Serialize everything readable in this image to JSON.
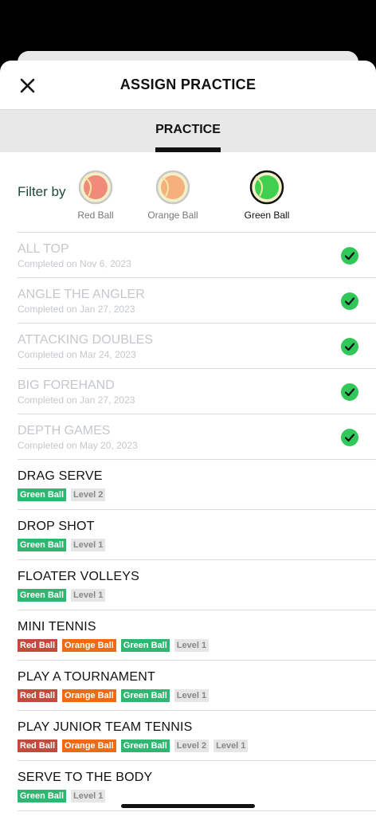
{
  "header": {
    "title": "ASSIGN PRACTICE"
  },
  "tabs": [
    {
      "label": "PRACTICE"
    }
  ],
  "filter": {
    "label": "Filter by",
    "balls": [
      {
        "label": "Red Ball",
        "color": "#f08a7a",
        "active": false
      },
      {
        "label": "Orange Ball",
        "color": "#f5b07e",
        "active": false
      },
      {
        "label": "Green Ball",
        "color": "#3fd04f",
        "active": true
      }
    ]
  },
  "completed": [
    {
      "name": "ALL TOP",
      "date": "Completed on Nov 6, 2023"
    },
    {
      "name": "ANGLE THE ANGLER",
      "date": "Completed on Jan 27, 2023"
    },
    {
      "name": "ATTACKING DOUBLES",
      "date": "Completed on Mar 24, 2023"
    },
    {
      "name": "BIG FOREHAND",
      "date": "Completed on Jan 27, 2023"
    },
    {
      "name": "DEPTH GAMES",
      "date": "Completed on May 20, 2023"
    }
  ],
  "practices": [
    {
      "name": "DRAG SERVE",
      "tags": [
        {
          "label": "Green Ball",
          "type": "green"
        },
        {
          "label": "Level 2",
          "type": "level"
        }
      ]
    },
    {
      "name": "DROP SHOT",
      "tags": [
        {
          "label": "Green Ball",
          "type": "green"
        },
        {
          "label": "Level 1",
          "type": "level"
        }
      ]
    },
    {
      "name": "FLOATER VOLLEYS",
      "tags": [
        {
          "label": "Green Ball",
          "type": "green"
        },
        {
          "label": "Level 1",
          "type": "level"
        }
      ]
    },
    {
      "name": "MINI TENNIS",
      "tags": [
        {
          "label": "Red Ball",
          "type": "red"
        },
        {
          "label": "Orange Ball",
          "type": "orange"
        },
        {
          "label": "Green Ball",
          "type": "green"
        },
        {
          "label": "Level 1",
          "type": "level"
        }
      ]
    },
    {
      "name": "PLAY A TOURNAMENT",
      "tags": [
        {
          "label": "Red Ball",
          "type": "red"
        },
        {
          "label": "Orange Ball",
          "type": "orange"
        },
        {
          "label": "Green Ball",
          "type": "green"
        },
        {
          "label": "Level 1",
          "type": "level"
        }
      ]
    },
    {
      "name": "PLAY JUNIOR TEAM TENNIS",
      "tags": [
        {
          "label": "Red Ball",
          "type": "red"
        },
        {
          "label": "Orange Ball",
          "type": "orange"
        },
        {
          "label": "Green Ball",
          "type": "green"
        },
        {
          "label": "Level 2",
          "type": "level"
        },
        {
          "label": "Level 1",
          "type": "level"
        }
      ]
    },
    {
      "name": "SERVE TO THE BODY",
      "tags": [
        {
          "label": "Green Ball",
          "type": "green"
        },
        {
          "label": "Level 1",
          "type": "level"
        }
      ]
    }
  ],
  "icons": {
    "close": "close-icon",
    "check": "checkmark-icon",
    "ball": "tennis-ball-icon"
  }
}
